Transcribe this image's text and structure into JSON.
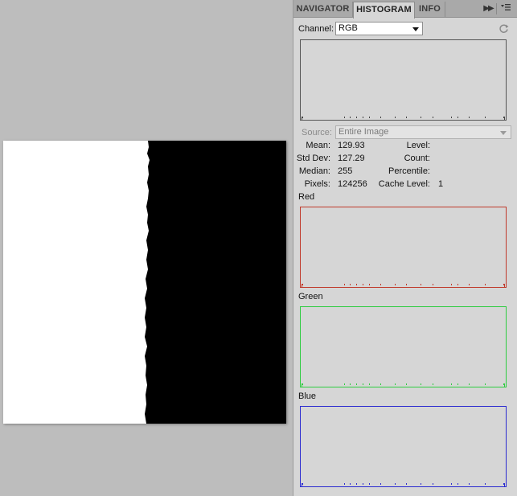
{
  "panel": {
    "tabs": [
      {
        "label": "NAVIGATOR",
        "active": false
      },
      {
        "label": "HISTOGRAM",
        "active": true
      },
      {
        "label": "INFO",
        "active": false
      }
    ],
    "channel_label": "Channel:",
    "channel_value": "RGB",
    "source_label": "Source:",
    "source_value": "Entire Image",
    "stats": {
      "mean_label": "Mean:",
      "mean_value": "129.93",
      "stddev_label": "Std Dev:",
      "stddev_value": "127.29",
      "median_label": "Median:",
      "median_value": "255",
      "pixels_label": "Pixels:",
      "pixels_value": "124256",
      "level_label": "Level:",
      "level_value": "",
      "count_label": "Count:",
      "count_value": "",
      "percentile_label": "Percentile:",
      "percentile_value": "",
      "cache_label": "Cache Level:",
      "cache_value": "1"
    },
    "channels": [
      {
        "label": "Red",
        "color": "#c0392b"
      },
      {
        "label": "Green",
        "color": "#2ecc40"
      },
      {
        "label": "Blue",
        "color": "#2b2bd0"
      }
    ],
    "composite_color": "#111111"
  },
  "document": {
    "white_color": "#ffffff",
    "black_color": "#000000"
  }
}
